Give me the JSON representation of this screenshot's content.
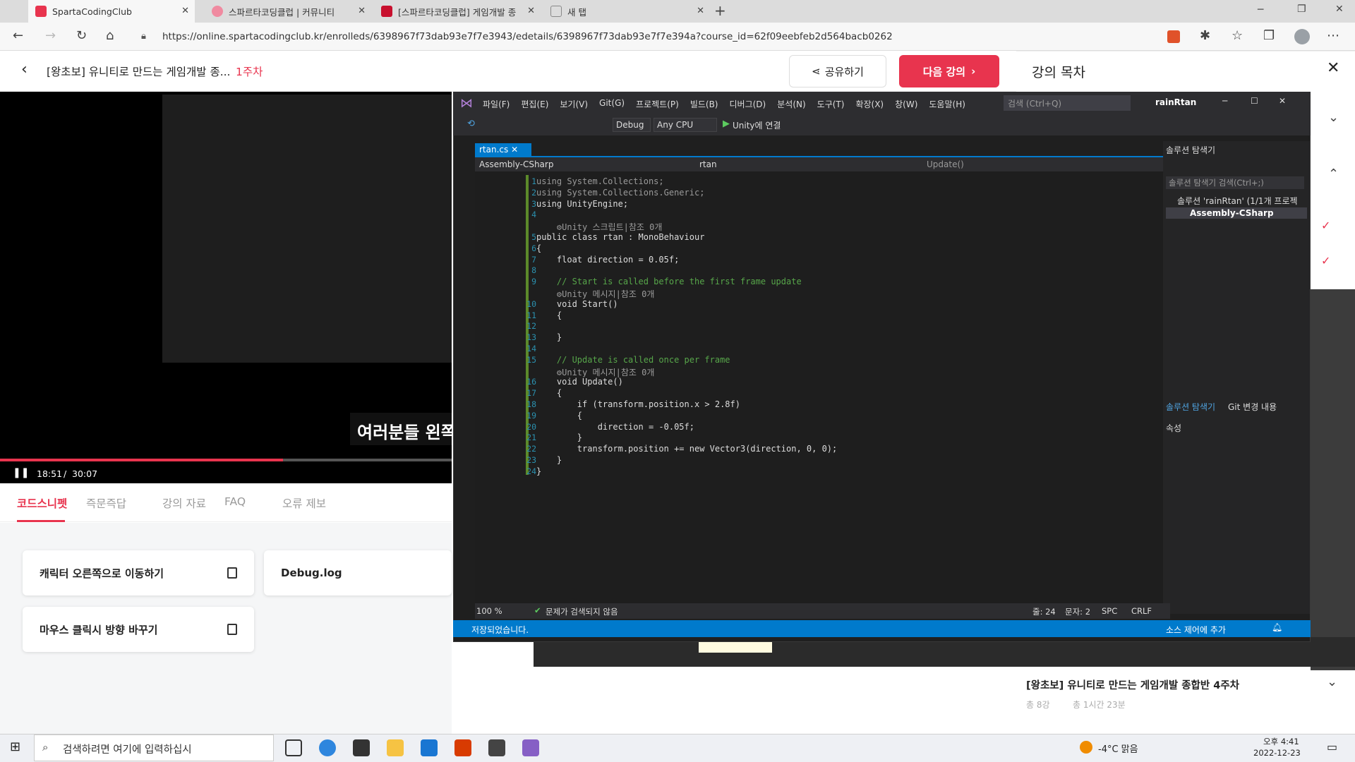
{
  "browser": {
    "tabs": [
      {
        "label": "SpartaCodingClub",
        "active": true
      },
      {
        "label": "스파르타코딩클럽 | 커뮤니티"
      },
      {
        "label": "[스파르타코딩클럽] 게임개발 종"
      },
      {
        "label": "새 탭"
      }
    ],
    "url": "https://online.spartacodingclub.kr/enrolleds/6398967f73dab93e7f7e3943/edetails/6398967f73dab93e7f7e394a?course_id=62f09eebfeb2d564bacb0262"
  },
  "page": {
    "course_title": "[왕초보] 유니티로 만드는 게임개발 종...",
    "week": "1주차",
    "share_label": "공유하기",
    "next_label": "다음 강의",
    "toc_title": "강의 목차",
    "video_caption": "여러분들 왼쪽",
    "time_current": "18:51",
    "time_total": "30:07",
    "tabs": [
      "코드스니펫",
      "즉문즉답",
      "강의 자료",
      "FAQ",
      "오류 제보"
    ],
    "snippets": [
      "캐릭터 오른쪽으로 이동하기",
      "Debug.log",
      "마우스 클릭시 방향 바꾸기"
    ],
    "course_card_title": "[왕초보] 유니티로 만드는 게임개발 종합반 4주차",
    "course_card_meta1": "총 8강",
    "course_card_meta2": "총 1시간 23분"
  },
  "vs": {
    "menus": [
      "파일(F)",
      "편집(E)",
      "보기(V)",
      "Git(G)",
      "프로젝트(P)",
      "빌드(B)",
      "디버그(D)",
      "분석(N)",
      "도구(T)",
      "확장(X)",
      "창(W)",
      "도움말(H)"
    ],
    "search_placeholder": "검색 (Ctrl+Q)",
    "solution_name": "rainRtan",
    "config": "Debug",
    "platform": "Any CPU",
    "run_label": "Unity에 연결",
    "file_tab": "rtan.cs",
    "nav_project": "Assembly-CSharp",
    "nav_class": "rtan",
    "nav_member": "Update()",
    "explorer_title": "솔루션 탐색기",
    "explorer_search": "솔루션 탐색기 검색(Ctrl+;)",
    "solution_item": "솔루션 'rainRtan' (1/1개 프로젝",
    "project_item": "Assembly-CSharp",
    "explorer_tab1": "솔루션 탐색기",
    "explorer_tab2": "Git 변경 내용",
    "props_title": "속성",
    "zoom": "100 %",
    "issues": "문제가 검색되지 않음",
    "line_info": "줄: 24",
    "col_info": "문자: 2",
    "spc": "SPC",
    "crlf": "CRLF",
    "status_saved": "저장되었습니다.",
    "source_control": "소스 제어에 추가"
  },
  "code": [
    {
      "n": "1",
      "t": "using System.Collections;",
      "c": "gr"
    },
    {
      "n": "2",
      "t": "using System.Collections.Generic;",
      "c": "gr"
    },
    {
      "n": "3",
      "t": "using UnityEngine;",
      "c": ""
    },
    {
      "n": "4",
      "t": "",
      "c": ""
    },
    {
      "n": "",
      "t": "    ⚙Unity 스크립트|참조 0개",
      "c": "gr"
    },
    {
      "n": "5",
      "t": "public class rtan : MonoBehaviour",
      "c": ""
    },
    {
      "n": "6",
      "t": "{",
      "c": ""
    },
    {
      "n": "7",
      "t": "    float direction = 0.05f;",
      "c": ""
    },
    {
      "n": "8",
      "t": "",
      "c": ""
    },
    {
      "n": "9",
      "t": "    // Start is called before the first frame update",
      "c": "cm"
    },
    {
      "n": "",
      "t": "    ⚙Unity 메시지|참조 0개",
      "c": "gr"
    },
    {
      "n": "10",
      "t": "    void Start()",
      "c": ""
    },
    {
      "n": "11",
      "t": "    {",
      "c": ""
    },
    {
      "n": "12",
      "t": "",
      "c": ""
    },
    {
      "n": "13",
      "t": "    }",
      "c": ""
    },
    {
      "n": "14",
      "t": "",
      "c": ""
    },
    {
      "n": "15",
      "t": "    // Update is called once per frame",
      "c": "cm"
    },
    {
      "n": "",
      "t": "    ⚙Unity 메시지|참조 0개",
      "c": "gr"
    },
    {
      "n": "16",
      "t": "    void Update()",
      "c": ""
    },
    {
      "n": "17",
      "t": "    {",
      "c": ""
    },
    {
      "n": "18",
      "t": "        if (transform.position.x > 2.8f)",
      "c": ""
    },
    {
      "n": "19",
      "t": "        {",
      "c": ""
    },
    {
      "n": "20",
      "t": "            direction = -0.05f;",
      "c": ""
    },
    {
      "n": "21",
      "t": "        }",
      "c": ""
    },
    {
      "n": "22",
      "t": "        transform.position += new Vector3(direction, 0, 0);",
      "c": ""
    },
    {
      "n": "23",
      "t": "    }",
      "c": ""
    },
    {
      "n": "24",
      "t": "}",
      "c": ""
    }
  ],
  "taskbar": {
    "search_placeholder": "검색하려면 여기에 입력하십시",
    "weather": "-4°C 맑음",
    "time": "오후 4:41",
    "date": "2022-12-23"
  }
}
